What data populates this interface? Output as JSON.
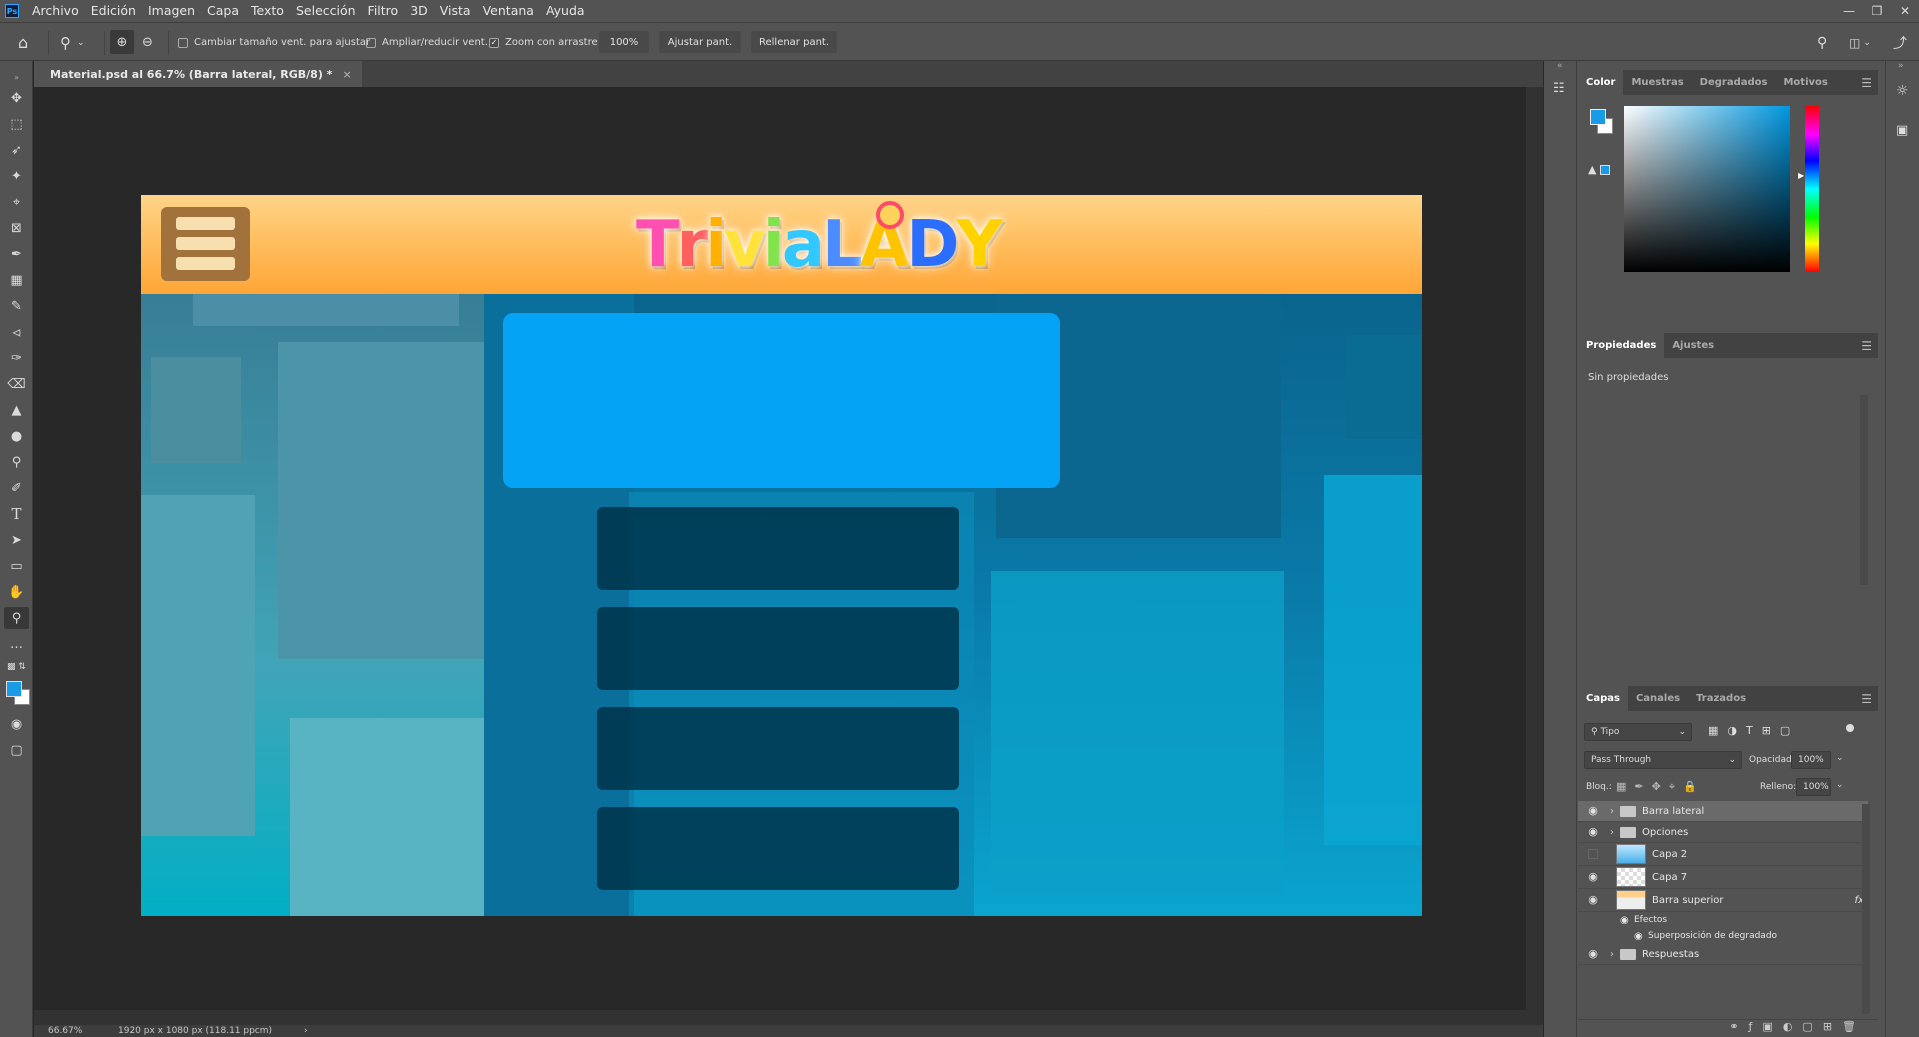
{
  "app": {
    "logo": "Ps",
    "menu": [
      "Archivo",
      "Edición",
      "Imagen",
      "Capa",
      "Texto",
      "Selección",
      "Filtro",
      "3D",
      "Vista",
      "Ventana",
      "Ayuda"
    ]
  },
  "options_bar": {
    "resize_windows_label": "Cambiar tamaño vent. para ajustar",
    "zoom_all_label": "Ampliar/reducir vent.",
    "scrubby_zoom_label": "Zoom con arrastre",
    "zoom_value": "100%",
    "fit_screen_label": "Ajustar pant.",
    "fill_screen_label": "Rellenar pant."
  },
  "document": {
    "tab_title": "Material.psd al 66.7% (Barra lateral, RGB/8) *",
    "close": "×",
    "logo_text": [
      "T",
      "r",
      "i",
      "v",
      "i",
      "a",
      "L",
      "A",
      "D",
      "Y"
    ],
    "logo_colors": [
      "#ff4fb1",
      "#ff5f5f",
      "#ffb000",
      "#ffe23a",
      "#7fe34a",
      "#31c8ff",
      "#4d8cff",
      "#ffc400",
      "#2b6dff",
      "#ffd200"
    ]
  },
  "status": {
    "zoom": "66.67%",
    "dimensions": "1920 px x 1080 px (118.11 ppcm)",
    "arrow": "›"
  },
  "color_panel": {
    "tabs": [
      "Color",
      "Muestras",
      "Degradados",
      "Motivos"
    ],
    "active": "Color",
    "foreground": "#1a9be8",
    "background": "#ffffff",
    "hue_base": "#0097e0"
  },
  "properties_panel": {
    "tabs": [
      "Propiedades",
      "Ajustes"
    ],
    "active": "Propiedades",
    "empty_text": "Sin propiedades"
  },
  "layers_panel": {
    "tabs": [
      "Capas",
      "Canales",
      "Trazados"
    ],
    "active": "Capas",
    "filter_label": "Tipo",
    "blend_mode": "Pass Through",
    "opacity_label": "Opacidad:",
    "opacity_value": "100%",
    "lock_label": "Bloq.:",
    "fill_label": "Relleno:",
    "fill_value": "100%",
    "layers": [
      {
        "name": "Barra lateral",
        "type": "group",
        "visible": true,
        "selected": true
      },
      {
        "name": "Opciones",
        "type": "group",
        "visible": true
      },
      {
        "name": "Capa 2",
        "type": "layer",
        "visible": false
      },
      {
        "name": "Capa 7",
        "type": "layer",
        "visible": true
      },
      {
        "name": "Barra superior",
        "type": "layer",
        "visible": true,
        "fx": "fx"
      },
      {
        "name": "Efectos",
        "type": "effects"
      },
      {
        "name": "Superposición de degradado",
        "type": "effect"
      },
      {
        "name": "Respuestas",
        "type": "group",
        "visible": true
      }
    ]
  }
}
